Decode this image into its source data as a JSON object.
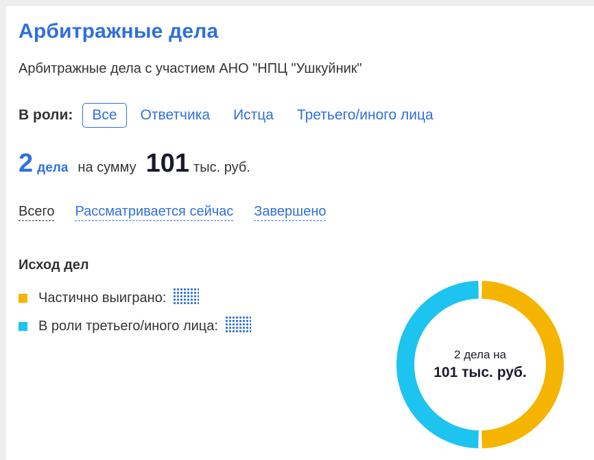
{
  "header": {
    "title": "Арбитражные дела",
    "subtitle": "Арбитражные дела с участием АНО \"НПЦ \"Ушкуйник\""
  },
  "roles": {
    "label": "В роли:",
    "options": [
      "Все",
      "Ответчика",
      "Истца",
      "Третьего/иного лица"
    ],
    "selected": "Все"
  },
  "summary": {
    "count": "2",
    "count_word": "дела",
    "on_sum": "на сумму",
    "amount": "101",
    "currency": "тыс. руб."
  },
  "filters": {
    "items": [
      "Всего",
      "Рассматривается сейчас",
      "Завершено"
    ],
    "selected": "Всего"
  },
  "outcome": {
    "title": "Исход дел",
    "legend": [
      {
        "label": "Частично выиграно:",
        "color": "#f5b400"
      },
      {
        "label": "В роли третьего/иного лица:",
        "color": "#1ec4f0"
      }
    ]
  },
  "chart_data": {
    "type": "pie",
    "categories": [
      "Частично выиграно",
      "В роли третьего/иного лица"
    ],
    "values": [
      1,
      1
    ],
    "colors": [
      "#f5b400",
      "#1ec4f0"
    ],
    "center_line1": "2 дела на",
    "center_line2": "101 тыс. руб."
  },
  "colors": {
    "accent": "#2f6fde",
    "dark": "#1a1a2e"
  }
}
